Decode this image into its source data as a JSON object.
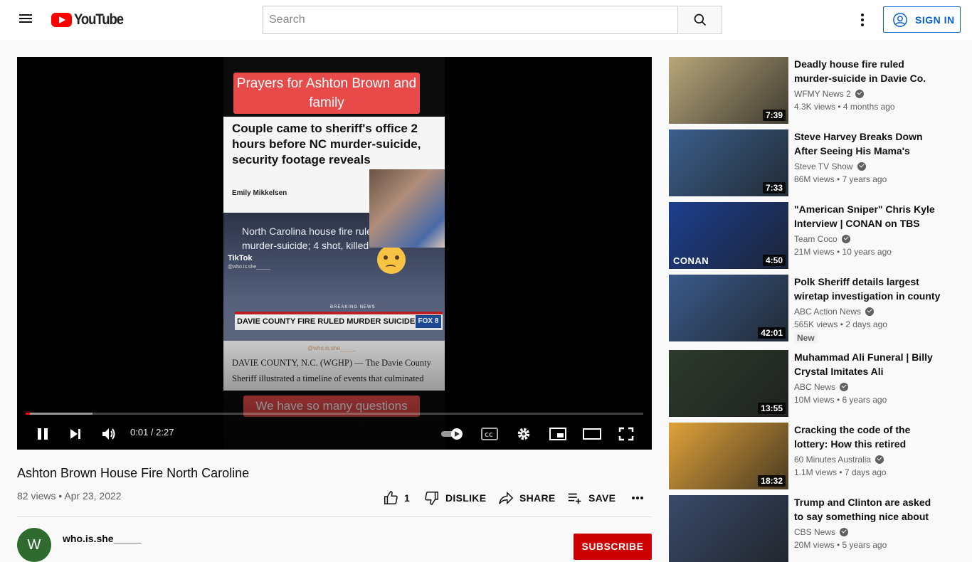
{
  "header": {
    "logo_text": "YouTube",
    "search_placeholder": "Search",
    "signin_label": "SIGN IN"
  },
  "player": {
    "frame": {
      "top_banner": "Prayers for Ashton Brown and family",
      "headline": "Couple came to sheriff's office 2 hours before NC murder-suicide, security footage reveals",
      "author": "Emily Mikkelsen",
      "cctv_text": "North Carolina house fire ruled murder-suicide; 4 shot, killed",
      "tiktok_label": "TikTok",
      "tiktok_handle": "@who.is.she_____",
      "breaking": "BREAKING NEWS",
      "chyron": "DAVIE COUNTY FIRE RULED MURDER SUICIDE",
      "station": "FOX 8",
      "lower_handle": "@who.is.she_____",
      "lower_text": "DAVIE COUNTY, N.C. (WGHP) — The Davie County Sheriff illustrated a timeline of events that culminated",
      "bottom_banner": "We have so many questions"
    },
    "time_display": "0:01 / 2:27",
    "progress_played_pct": 0.7,
    "progress_loaded_pct": 10.8
  },
  "video": {
    "title": "Ashton Brown House Fire North Caroline",
    "meta": "82 views • Apr 23, 2022",
    "like_count": "1",
    "dislike_label": "DISLIKE",
    "share_label": "SHARE",
    "save_label": "SAVE"
  },
  "channel": {
    "avatar_letter": "W",
    "name": "who.is.she_____",
    "subscribe_label": "SUBSCRIBE"
  },
  "recommendations": [
    {
      "title": "Deadly house fire ruled murder-suicide in Davie Co.",
      "channel": "WFMY News 2",
      "meta": "4.3K views • 4 months ago",
      "duration": "7:39",
      "badge": "",
      "thumb_color": "#b7a77a"
    },
    {
      "title": "Steve Harvey Breaks Down After Seeing His Mama's House",
      "channel": "Steve TV Show",
      "meta": "86M views • 7 years ago",
      "duration": "7:33",
      "badge": "",
      "thumb_color": "#3b5f8c"
    },
    {
      "title": "\"American Sniper\" Chris Kyle Interview | CONAN on TBS",
      "channel": "Team Coco",
      "meta": "21M views • 10 years ago",
      "duration": "4:50",
      "badge": "",
      "thumb_color": "#1d3f8f",
      "tag": "CONAN"
    },
    {
      "title": "Polk Sheriff details largest wiretap investigation in county history",
      "channel": "ABC Action News",
      "meta": "565K views • 2 days ago",
      "duration": "42:01",
      "badge": "New",
      "thumb_color": "#3a5a8a"
    },
    {
      "title": "Muhammad Ali Funeral | Billy Crystal Imitates Ali",
      "channel": "ABC News",
      "meta": "10M views • 6 years ago",
      "duration": "13:55",
      "badge": "",
      "thumb_color": "#2d3a2d"
    },
    {
      "title": "Cracking the code of the lottery: How this retired couple won millions",
      "channel": "60 Minutes Australia",
      "meta": "1.1M views • 7 days ago",
      "duration": "18:32",
      "badge": "",
      "thumb_color": "#e0a23a"
    },
    {
      "title": "Trump and Clinton are asked to say something nice about each other",
      "channel": "CBS News",
      "meta": "20M views • 5 years ago",
      "duration": "",
      "badge": "",
      "thumb_color": "#3a4a6a"
    }
  ],
  "colors": {
    "brand_red": "#ff0000",
    "link_blue": "#065fd4",
    "subscribe_red": "#cc0000"
  },
  "icons": [
    "menu-icon",
    "youtube-logo-icon",
    "search-icon",
    "more-vert-icon",
    "account-icon",
    "pause-icon",
    "next-icon",
    "volume-icon",
    "autoplay-icon",
    "captions-icon",
    "settings-icon",
    "miniplayer-icon",
    "theater-icon",
    "fullscreen-icon",
    "like-icon",
    "dislike-icon",
    "share-icon",
    "save-icon",
    "more-horiz-icon",
    "verified-icon"
  ]
}
